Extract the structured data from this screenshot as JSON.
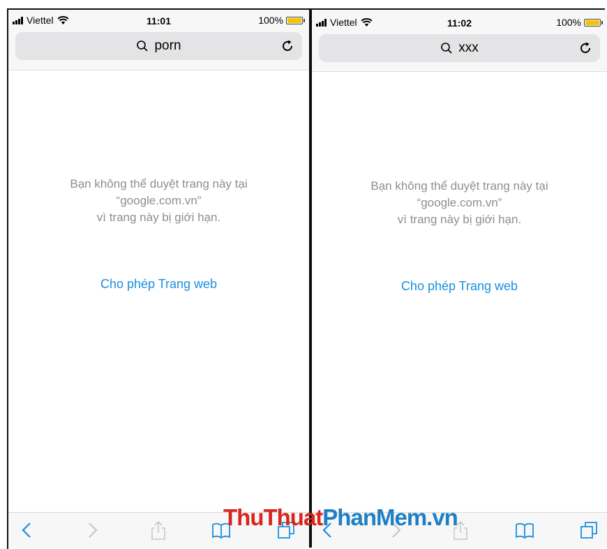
{
  "left": {
    "carrier": "Viettel",
    "time": "11:01",
    "battery": "100%",
    "search_query": "porn",
    "message_line1": "Bạn không thể duyệt trang này tại",
    "message_line2": "“google.com.vn”",
    "message_line3": "vì trang này bị giới hạn.",
    "allow_link": "Cho phép Trang web"
  },
  "right": {
    "carrier": "Viettel",
    "time": "11:02",
    "battery": "100%",
    "search_query": "xxx",
    "message_line1": "Bạn không thể duyệt trang này tại",
    "message_line2": "“google.com.vn”",
    "message_line3": "vì trang này bị giới hạn.",
    "allow_link": "Cho phép Trang web"
  },
  "watermark": {
    "part1": "ThuThuat",
    "part2": "PhanMem.vn"
  },
  "colors": {
    "link": "#1a8fe0",
    "battery": "#f5c400",
    "watermark_red": "#d9261c",
    "watermark_blue": "#1e7fc4"
  }
}
